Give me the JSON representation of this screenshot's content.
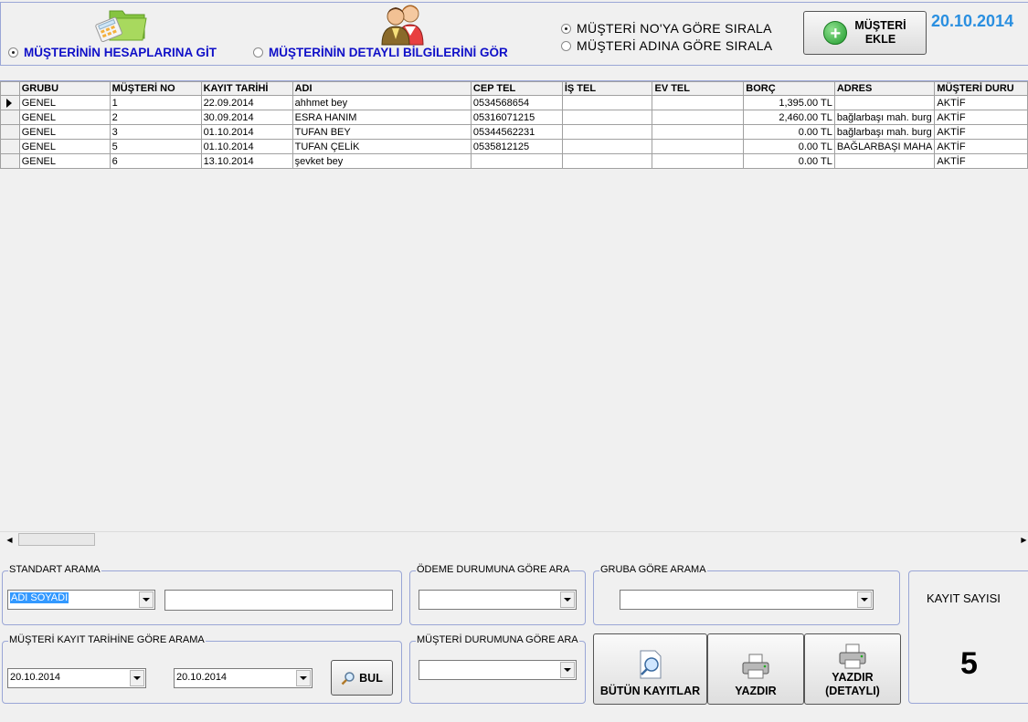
{
  "top": {
    "nav_options": [
      {
        "label": "MÜŞTERİNİN HESAPLARINA GİT",
        "selected": true
      },
      {
        "label": "MÜŞTERİNİN DETAYLI BİLGİLERİNİ GÖR",
        "selected": false
      }
    ],
    "sort_options": [
      {
        "label": "MÜŞTERİ NO'YA GÖRE SIRALA",
        "selected": true
      },
      {
        "label": "MÜŞTERİ ADINA GÖRE SIRALA",
        "selected": false
      }
    ],
    "add_customer_label": "MÜŞTERİ\nEKLE",
    "date": "20.10.2014",
    "accent_color": "#2a8fe0",
    "nav_color": "#1010c8"
  },
  "grid": {
    "columns": [
      "GRUBU",
      "MÜŞTERİ NO",
      "KAYIT TARİHİ",
      "ADI",
      "CEP TEL",
      "İŞ TEL",
      "EV TEL",
      "BORÇ",
      "ADRES",
      "MÜŞTERİ DURU"
    ],
    "rows": [
      [
        "GENEL",
        "1",
        "22.09.2014",
        "ahhmet bey",
        "0534568654",
        "",
        "",
        "1,395.00 TL",
        "",
        "AKTİF"
      ],
      [
        "GENEL",
        "2",
        "30.09.2014",
        "ESRA HANIM",
        "05316071215",
        "",
        "",
        "2,460.00 TL",
        "bağlarbaşı mah. burg",
        "AKTİF"
      ],
      [
        "GENEL",
        "3",
        "01.10.2014",
        "TUFAN BEY",
        "05344562231",
        "",
        "",
        "0.00 TL",
        "bağlarbaşı mah. burg",
        "AKTİF"
      ],
      [
        "GENEL",
        "5",
        "01.10.2014",
        "TUFAN ÇELİK",
        "0535812125",
        "",
        "",
        "0.00 TL",
        "BAĞLARBAŞI MAHA",
        "AKTİF"
      ],
      [
        "GENEL",
        "6",
        "13.10.2014",
        "şevket bey",
        "",
        "",
        "",
        "0.00 TL",
        "",
        "AKTİF"
      ]
    ],
    "selected_row": 0
  },
  "search": {
    "standard_title": "STANDART ARAMA",
    "standard_field": "ADI SOYADI",
    "standard_text": "",
    "payment_title": "ÖDEME DURUMUNA GÖRE ARA",
    "payment_value": "",
    "group_title": "GRUBA GÖRE ARAMA",
    "group_value": "",
    "date_title": "MÜŞTERİ KAYIT TARİHİNE GÖRE ARAMA",
    "date_from": "20.10.2014",
    "date_to": "20.10.2014",
    "find_label": "BUL",
    "status_title": "MÜŞTERİ DURUMUNA GÖRE ARA",
    "status_value": ""
  },
  "actions": {
    "all_records_label": "BÜTÜN KAYITLAR",
    "print_label": "YAZDIR",
    "print_detailed_label": "YAZDIR\n(DETAYLI)"
  },
  "record_count": {
    "title": "KAYIT SAYISI",
    "value": "5"
  },
  "icons": {
    "nav_accounts": "calculator-folder-icon",
    "nav_details": "users-icon",
    "add": "plus-circle-icon",
    "search": "magnifier-icon",
    "print": "printer-icon"
  }
}
